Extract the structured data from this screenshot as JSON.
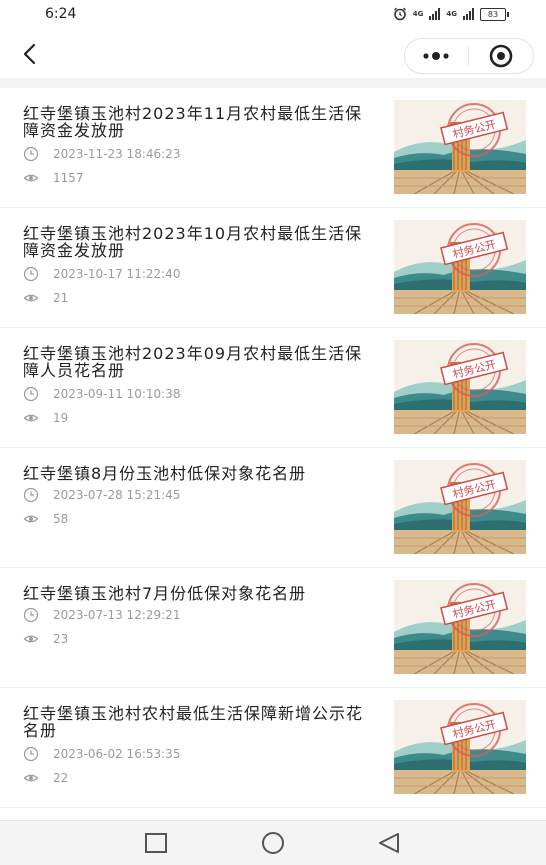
{
  "status": {
    "time": "6:24",
    "net1": "4G",
    "net2": "4G",
    "battery": "83"
  },
  "icons": {
    "back": "chevron-left-icon",
    "more": "more-dots-icon",
    "close": "target-close-icon",
    "time": "clock-icon",
    "views": "eye-icon"
  },
  "thumbnail": {
    "stamp_text": "村务公开"
  },
  "articles": [
    {
      "title": "红寺堡镇玉池村2023年11月农村最低生活保障资金发放册",
      "date": "2023-11-23  18:46:23",
      "views": "1157"
    },
    {
      "title": "红寺堡镇玉池村2023年10月农村最低生活保障资金发放册",
      "date": "2023-10-17  11:22:40",
      "views": "21"
    },
    {
      "title": "红寺堡镇玉池村2023年09月农村最低生活保障人员花名册",
      "date": "2023-09-11  10:10:38",
      "views": "19"
    },
    {
      "title": "红寺堡镇8月份玉池村低保对象花名册",
      "date": "2023-07-28  15:21:45",
      "views": "58"
    },
    {
      "title": "红寺堡镇玉池村7月份低保对象花名册",
      "date": "2023-07-13  12:29:21",
      "views": "23"
    },
    {
      "title": "红寺堡镇玉池村农村最低生活保障新增公示花名册",
      "date": "2023-06-02  16:53:35",
      "views": "22"
    }
  ],
  "navbar_buttons": {
    "recent": "square-recent-icon",
    "home": "circle-home-icon",
    "back": "triangle-back-icon"
  }
}
